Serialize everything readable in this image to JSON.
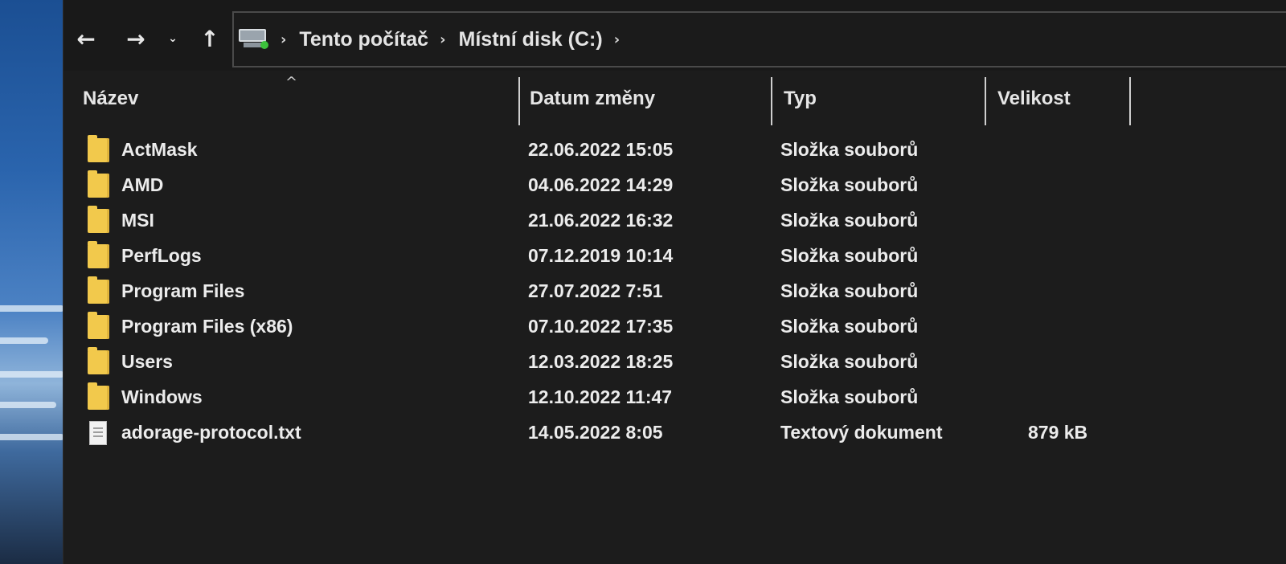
{
  "window": {
    "nav": {
      "back": "←",
      "forward": "→",
      "recent": "⌄",
      "up": "↑"
    },
    "address_bar": {
      "icon": "computer-icon",
      "breadcrumbs": [
        "Tento počítač",
        "Místní disk (C:)"
      ],
      "separator": "›"
    }
  },
  "columns": {
    "name": "Název",
    "date": "Datum změny",
    "type": "Typ",
    "size": "Velikost",
    "sort_indicator": "^"
  },
  "files": [
    {
      "icon": "folder-icon",
      "name": "ActMask",
      "date": "22.06.2022 15:05",
      "type": "Složka souborů",
      "size": ""
    },
    {
      "icon": "folder-icon",
      "name": "AMD",
      "date": "04.06.2022 14:29",
      "type": "Složka souborů",
      "size": ""
    },
    {
      "icon": "folder-icon",
      "name": "MSI",
      "date": "21.06.2022 16:32",
      "type": "Složka souborů",
      "size": ""
    },
    {
      "icon": "folder-icon",
      "name": "PerfLogs",
      "date": "07.12.2019 10:14",
      "type": "Složka souborů",
      "size": ""
    },
    {
      "icon": "folder-icon",
      "name": "Program Files",
      "date": "27.07.2022 7:51",
      "type": "Složka souborů",
      "size": ""
    },
    {
      "icon": "folder-icon",
      "name": "Program Files (x86)",
      "date": "07.10.2022 17:35",
      "type": "Složka souborů",
      "size": ""
    },
    {
      "icon": "folder-icon",
      "name": "Users",
      "date": "12.03.2022 18:25",
      "type": "Složka souborů",
      "size": ""
    },
    {
      "icon": "folder-icon",
      "name": "Windows",
      "date": "12.10.2022 11:47",
      "type": "Složka souborů",
      "size": ""
    },
    {
      "icon": "text-file-icon",
      "name": "adorage-protocol.txt",
      "date": "14.05.2022 8:05",
      "type": "Textový dokument",
      "size": "879 kB"
    }
  ],
  "colors": {
    "window_bg": "#1c1c1c",
    "folder": "#f2c94c",
    "text": "#ececec"
  }
}
